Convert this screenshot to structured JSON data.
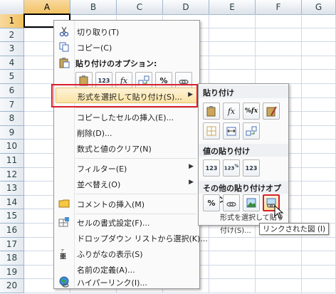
{
  "columns": [
    "A",
    "B",
    "C",
    "D",
    "E",
    "F",
    "G"
  ],
  "rows": [
    "1",
    "2",
    "3",
    "4",
    "5",
    "6",
    "7",
    "8",
    "9",
    "10",
    "11",
    "12",
    "13",
    "14",
    "15",
    "16",
    "17",
    "18",
    "19",
    "20"
  ],
  "menu": {
    "cut": "切り取り(T)",
    "copy": "コピー(C)",
    "paste_options": "貼り付けのオプション:",
    "paste_special": "形式を選択して貼り付け(S)...",
    "insert_copied": "コピーしたセルの挿入(E)...",
    "delete": "削除(D)...",
    "clear": "数式と値のクリア(N)",
    "filter": "フィルター(E)",
    "sort": "並べ替え(O)",
    "insert_comment": "コメントの挿入(M)",
    "format_cells": "セルの書式設定(F)...",
    "pick_list": "ドロップダウン リストから選択(K)...",
    "phonetic": "ふりがなの表示(S)",
    "define_name": "名前の定義(A)...",
    "hyperlink": "ハイパーリンク(I)..."
  },
  "submenu": {
    "paste": "貼り付け",
    "paste_values": "値の貼り付け",
    "other_paste": "その他の貼り付けオプション",
    "footer": "形式を選択して貼り付け(S)..."
  },
  "tooltip": "リンクされた図 (I)",
  "paste_icon_labels": {
    "values_123": "123",
    "formula_fx": "fx",
    "percent": "%"
  },
  "colors": {
    "highlight_border": "#d8202a",
    "header_selected": "#f1c15f"
  }
}
